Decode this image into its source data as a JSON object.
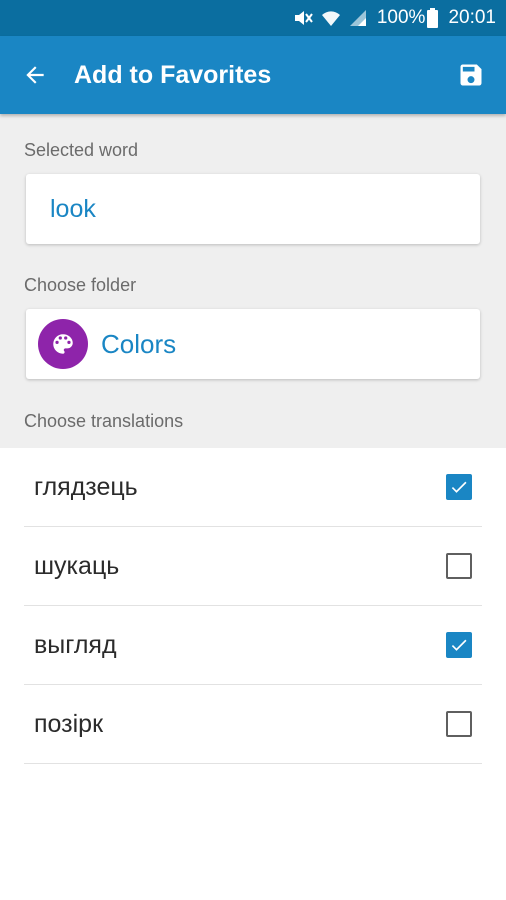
{
  "status_bar": {
    "battery": "100%",
    "time": "20:01",
    "icons": [
      "mute-icon",
      "wifi-icon",
      "signal-icon",
      "battery-icon"
    ]
  },
  "app_bar": {
    "title": "Add to Favorites",
    "back_icon": "arrow-back-icon",
    "save_icon": "save-icon"
  },
  "selected_word": {
    "label": "Selected word",
    "value": "look"
  },
  "folder": {
    "label": "Choose folder",
    "name": "Colors",
    "icon": "palette-icon"
  },
  "translations": {
    "label": "Choose translations",
    "items": [
      {
        "text": "глядзець",
        "checked": true
      },
      {
        "text": "шукаць",
        "checked": false
      },
      {
        "text": "выгляд",
        "checked": true
      },
      {
        "text": "позірк",
        "checked": false
      }
    ]
  },
  "colors": {
    "status_bar": "#0b6ea0",
    "app_bar": "#1a86c4",
    "accent": "#1a86c4",
    "folder_icon": "#8e24aa",
    "form_background": "#efefef"
  }
}
